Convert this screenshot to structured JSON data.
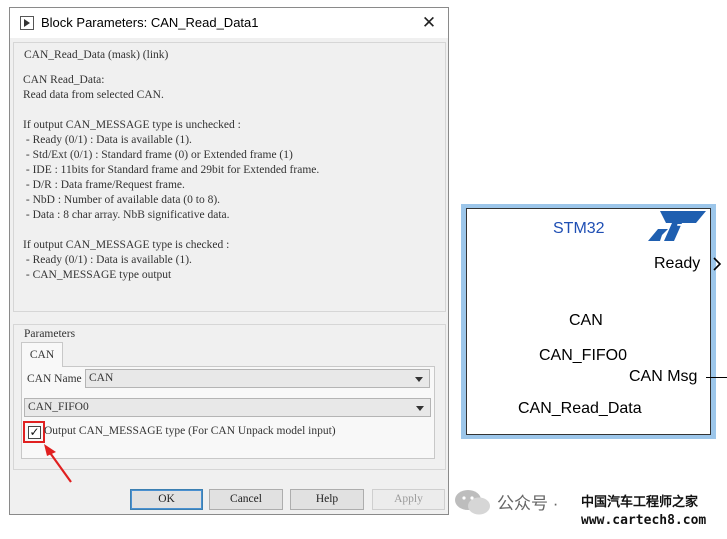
{
  "dialog": {
    "title": "Block Parameters: CAN_Read_Data1",
    "close_glyph": "✕",
    "description_group": {
      "legend": "CAN_Read_Data (mask) (link)",
      "text": "CAN Read_Data:\nRead data from selected CAN.\n\nIf output CAN_MESSAGE type is unchecked :\n - Ready (0/1) : Data is available (1).\n - Std/Ext (0/1) : Standard frame (0) or Extended frame (1)\n - IDE : 11bits for Standard frame and 29bit for Extended frame.\n - D/R : Data frame/Request frame.\n - NbD : Number of available data (0 to 8).\n - Data : 8 char array. NbB significative data.\n\nIf output CAN_MESSAGE type is checked :\n - Ready (0/1) : Data is available (1).\n - CAN_MESSAGE type output"
    },
    "parameters": {
      "legend": "Parameters",
      "tab_label": "CAN",
      "can_name_label": "CAN Name",
      "can_name_value": "CAN",
      "fifo_value": "CAN_FIFO0",
      "checkbox_checked": true,
      "checkbox_glyph": "✓",
      "checkbox_label": "Output CAN_MESSAGE type (For CAN Unpack model input)"
    },
    "buttons": {
      "ok": "OK",
      "cancel": "Cancel",
      "help": "Help",
      "apply": "Apply"
    },
    "annotation_color": "#e02020"
  },
  "block": {
    "vendor_label": "STM32",
    "ready_port": "Ready",
    "can_label": "CAN",
    "fifo_label": "CAN_FIFO0",
    "canmsg_port": "CAN Msg",
    "name_label": "CAN_Read_Data",
    "logo_icon": "st-logo-icon",
    "border_color": "#9cc6ea",
    "vendor_color": "#1f4fb4"
  },
  "watermark": {
    "wechat_text": "公众号 ·",
    "site_cn": "中国汽车工程师之家",
    "site_url": "www.cartech8.com"
  }
}
